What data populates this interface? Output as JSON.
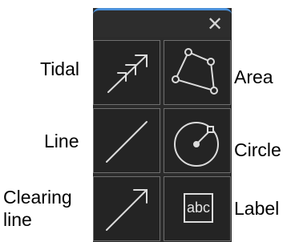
{
  "labels": {
    "tidal": "Tidal",
    "area": "Area",
    "line": "Line",
    "circle": "Circle",
    "clearing_line_1": "Clearing",
    "clearing_line_2": "line",
    "label": "Label"
  },
  "panel": {
    "close_glyph": "✕",
    "tools": [
      {
        "name": "tidal",
        "icon": "tidal-arrow-icon"
      },
      {
        "name": "area",
        "icon": "polygon-icon"
      },
      {
        "name": "line",
        "icon": "line-icon"
      },
      {
        "name": "circle",
        "icon": "circle-icon"
      },
      {
        "name": "clearing-line",
        "icon": "arrow-line-icon"
      },
      {
        "name": "label",
        "icon": "text-label-icon",
        "text": "abc"
      }
    ]
  },
  "colors": {
    "panel_bg": "#2b2b2b",
    "tile_border": "#6f6f6f",
    "icon_stroke": "#dcdcdc",
    "accent": "#4a90d9"
  }
}
